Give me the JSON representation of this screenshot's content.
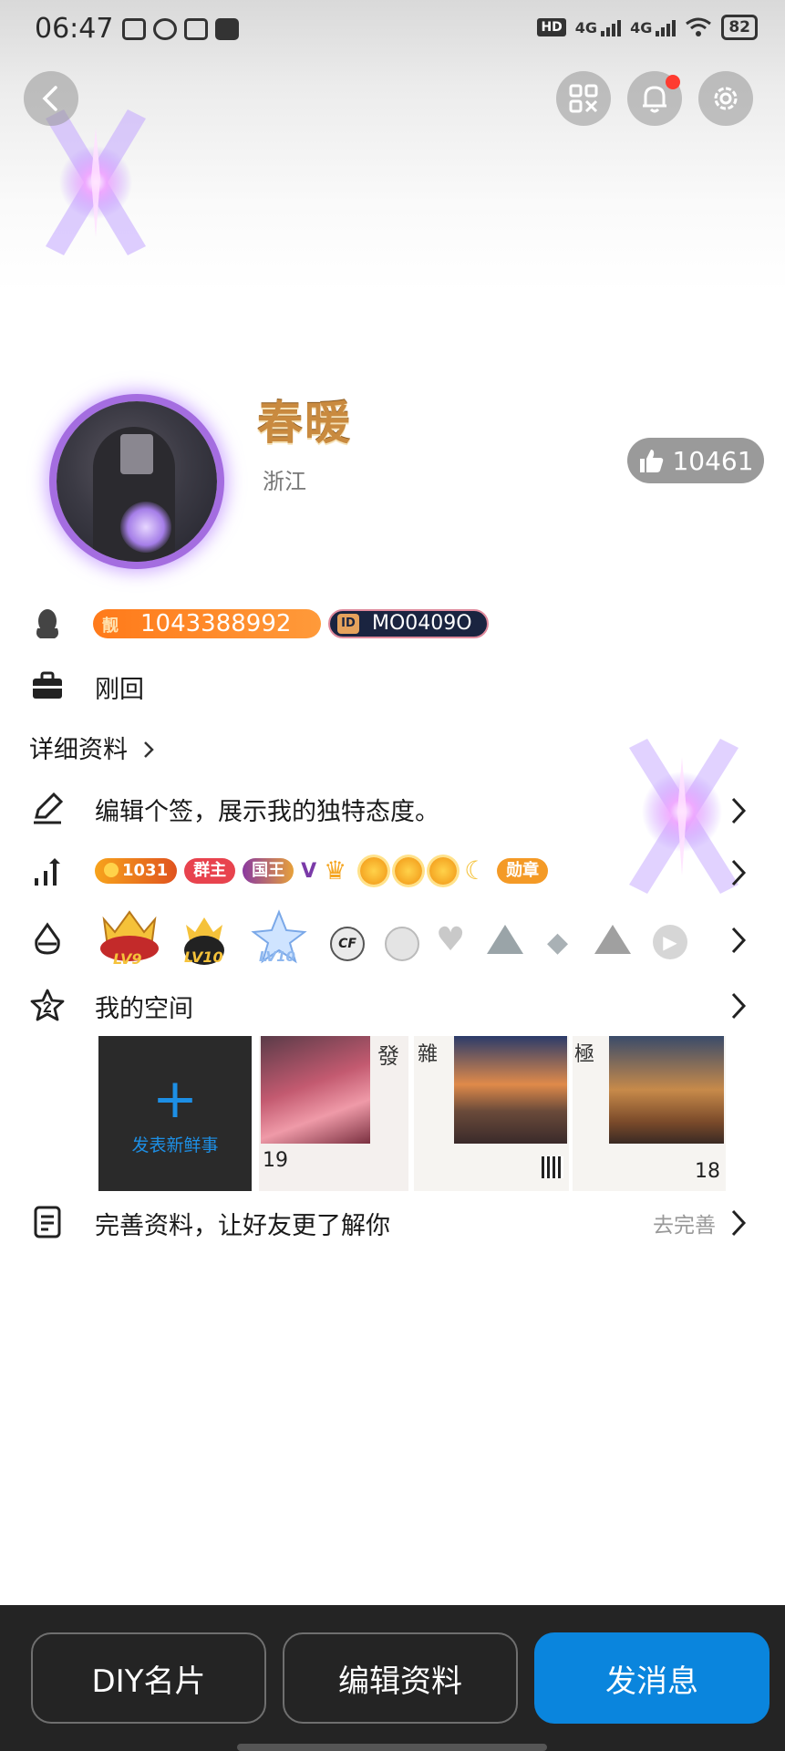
{
  "status_bar": {
    "time": "06:47",
    "hd_label": "HD",
    "network_1": "4G",
    "network_2": "4G",
    "battery": "82"
  },
  "nav": {
    "back_icon": "chevron-left-icon",
    "qr_icon": "qr-code-icon",
    "bell_icon": "bell-icon",
    "settings_icon": "gear-icon",
    "has_notification": true
  },
  "profile": {
    "name": "春暖",
    "location": "浙江",
    "likes": "10461",
    "qq_number": "1043388992",
    "qq_tag": "靓",
    "id_code": "MO0409O",
    "id_tag": "ID",
    "status": "刚回"
  },
  "detail_link": "详细资料",
  "signature": "编辑个签，展示我的独特态度。",
  "levels": {
    "coins": "1031",
    "group_owner": "群主",
    "king_badge": "国王",
    "medal": "勋章"
  },
  "game_badges": {
    "level_1": "LV9",
    "level_2": "LV10",
    "level_3": "LV10"
  },
  "space": {
    "title": "我的空间",
    "publish_label": "发表新鲜事",
    "tiles": [
      {
        "char": "發",
        "day": "19"
      },
      {
        "char": "雜",
        "day": ""
      },
      {
        "char": "極",
        "day": "18"
      }
    ]
  },
  "complete_profile": {
    "text": "完善资料，让好友更了解你",
    "action": "去完善"
  },
  "bottom_bar": {
    "diy": "DIY名片",
    "edit": "编辑资料",
    "message": "发消息"
  },
  "colors": {
    "primary_button": "#0a85dd",
    "username_gold": "#c98a3f",
    "qq_badge": "#ff7a1a",
    "notification_dot": "#ff3b30"
  }
}
